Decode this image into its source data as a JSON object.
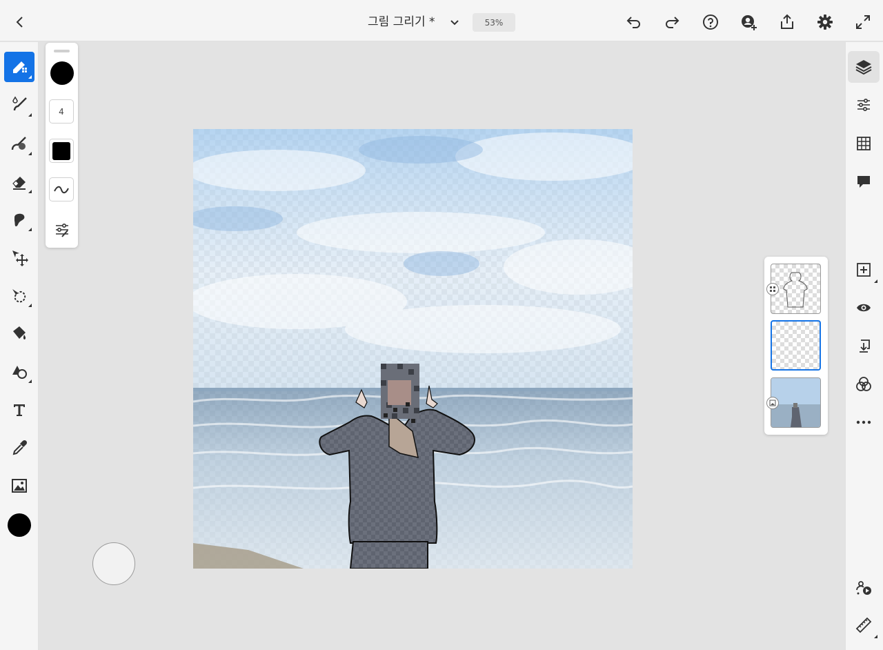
{
  "header": {
    "title": "그림 그리기 *",
    "zoom": "53%"
  },
  "properties": {
    "brush_size": "4"
  },
  "colors": {
    "accent": "#1473e6",
    "current_color": "#000000"
  },
  "icons": {
    "left_tools": [
      "pixel-brush-icon",
      "live-brush-icon",
      "mixer-brush-icon",
      "eraser-icon",
      "smudge-icon",
      "move-icon",
      "lasso-icon",
      "fill-icon",
      "shape-icon",
      "text-icon",
      "eyedropper-icon",
      "image-icon",
      "color-swatch"
    ],
    "right_tools": [
      "layers-icon",
      "layer-properties-icon",
      "grid-icon",
      "comment-icon",
      "add-layer-icon",
      "visibility-icon",
      "merge-down-icon",
      "blend-mode-icon",
      "more-icon",
      "share-livestream-icon",
      "ruler-icon"
    ]
  }
}
